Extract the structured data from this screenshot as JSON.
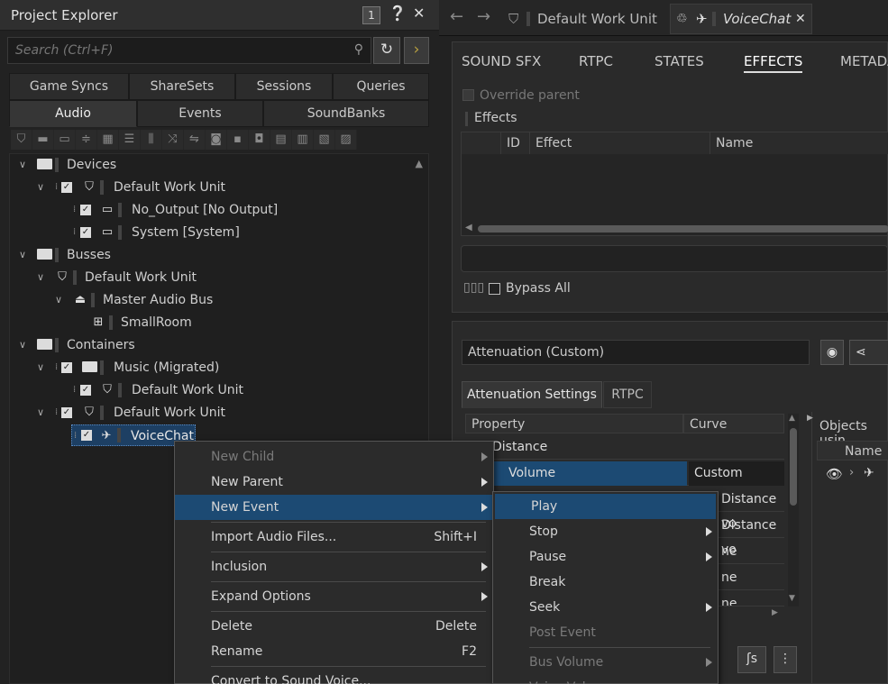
{
  "explorer": {
    "title": "Project Explorer",
    "badge": "1",
    "help_icon": "help-icon",
    "close_icon": "close-icon",
    "search_placeholder": "Search (Ctrl+F)",
    "tabs_top": [
      "Game Syncs",
      "ShareSets",
      "Sessions",
      "Queries"
    ],
    "tabs_bottom": [
      "Audio",
      "Events",
      "SoundBanks"
    ],
    "tree": [
      {
        "label": "Devices",
        "indent": 0,
        "type": "folder"
      },
      {
        "label": "Default Work Unit",
        "indent": 1,
        "type": "workunit"
      },
      {
        "label": "No_Output [No Output]",
        "indent": 2,
        "type": "device"
      },
      {
        "label": "System [System]",
        "indent": 2,
        "type": "device"
      },
      {
        "label": "Busses",
        "indent": 0,
        "type": "folder"
      },
      {
        "label": "Default Work Unit",
        "indent": 1,
        "type": "workunit"
      },
      {
        "label": "Master Audio Bus",
        "indent": 2,
        "type": "bus"
      },
      {
        "label": "SmallRoom",
        "indent": 3,
        "type": "auxbus"
      },
      {
        "label": "Containers",
        "indent": 0,
        "type": "folder"
      },
      {
        "label": "Music (Migrated)",
        "indent": 1,
        "type": "folder"
      },
      {
        "label": "Default Work Unit",
        "indent": 2,
        "type": "workunit"
      },
      {
        "label": "Default Work Unit",
        "indent": 1,
        "type": "workunit"
      },
      {
        "label": "VoiceChat",
        "indent": 2,
        "type": "sound",
        "selected": true
      }
    ]
  },
  "editor": {
    "tab1": "Default Work Unit",
    "tab2": "VoiceChat",
    "panel_tabs": [
      "SOUND SFX",
      "RTPC",
      "STATES",
      "EFFECTS",
      "METADA"
    ],
    "active_tab": "EFFECTS",
    "override_parent": "Override parent",
    "effects_label": "Effects",
    "grid_cols": [
      "ID",
      "Effect",
      "Name"
    ],
    "bypass_all": "Bypass All",
    "attenuation_field": "Attenuation (Custom)",
    "att_tabs": [
      "Attenuation Settings",
      "RTPC"
    ],
    "prop_cols": [
      "Property",
      "Curve"
    ],
    "prop_rows": [
      {
        "property": "Distance",
        "curve": ""
      },
      {
        "property": "Volume",
        "curve": "Custom"
      },
      {
        "property": "",
        "curve": "Distance vo"
      },
      {
        "property": "",
        "curve": "Distance vo"
      },
      {
        "property": "",
        "curve": "ne"
      },
      {
        "property": "",
        "curve": "ne"
      },
      {
        "property": "",
        "curve": "ne"
      }
    ],
    "objects_using": "Objects usin",
    "name_col": "Name"
  },
  "context_menu": [
    {
      "label": "New Child",
      "disabled": true,
      "submenu": true
    },
    {
      "label": "New Parent",
      "submenu": true
    },
    {
      "label": "New Event",
      "submenu": true,
      "highlight": true
    },
    {
      "sep": true
    },
    {
      "label": "Import Audio Files...",
      "shortcut": "Shift+I"
    },
    {
      "sep": true
    },
    {
      "label": "Inclusion",
      "submenu": true
    },
    {
      "sep": true
    },
    {
      "label": "Expand Options",
      "submenu": true
    },
    {
      "sep": true
    },
    {
      "label": "Delete",
      "shortcut": "Delete"
    },
    {
      "label": "Rename",
      "shortcut": "F2"
    },
    {
      "sep": true
    },
    {
      "label": "Convert to Sound Voice..."
    }
  ],
  "sub_menu": [
    {
      "label": "Play",
      "highlight": true
    },
    {
      "label": "Stop",
      "submenu": true
    },
    {
      "label": "Pause",
      "submenu": true
    },
    {
      "label": "Break"
    },
    {
      "label": "Seek",
      "submenu": true
    },
    {
      "label": "Post Event",
      "disabled": true
    },
    {
      "sep": true
    },
    {
      "label": "Bus Volume",
      "disabled": true,
      "submenu": true
    },
    {
      "label": "Voice Volume",
      "disabled": true,
      "submenu": true
    }
  ]
}
